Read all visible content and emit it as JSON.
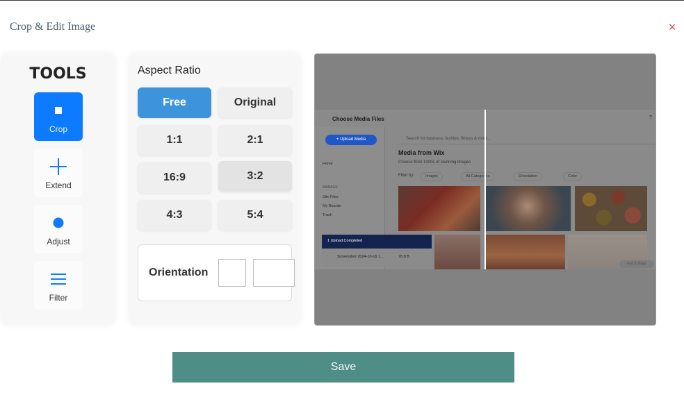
{
  "modal": {
    "title": "Crop & Edit Image",
    "close_symbol": "×"
  },
  "tools": {
    "title": "TOOLS",
    "items": [
      {
        "label": "Crop",
        "icon": "square-icon",
        "active": true
      },
      {
        "label": "Extend",
        "icon": "plus-icon",
        "active": false
      },
      {
        "label": "Adjust",
        "icon": "circle-icon",
        "active": false
      },
      {
        "label": "Filter",
        "icon": "menu-lines-icon",
        "active": false
      }
    ]
  },
  "aspect": {
    "title": "Aspect Ratio",
    "options": [
      "Free",
      "Original",
      "1:1",
      "2:1",
      "16:9",
      "3:2",
      "4:3",
      "5:4"
    ],
    "selected": "Free",
    "orientation_label": "Orientation"
  },
  "preview": {
    "dialog_title": "Choose Media Files",
    "help": "?",
    "close": "×",
    "upload_button": "+ Upload Media",
    "nav": [
      "Home",
      "MANAGE",
      "Site Files",
      "My Boards",
      "Trash"
    ],
    "search_placeholder": "Search for business, fashion, fitness & more...",
    "heading": "Media from Wix",
    "subheading": "Choose from 1000s of stunning images",
    "filter_label": "Filter by:",
    "filters": [
      "Images",
      "All Categories",
      "Orientation",
      "Color"
    ],
    "toast": "1 Upload Completed",
    "file_name": "Screenshot 2024-10-16 1...",
    "file_size": "78.8 B",
    "add_button": "Add to Page"
  },
  "colors": {
    "accent": "#0d7bff",
    "selected": "#3d94dd",
    "save": "#4f8d87",
    "close": "#e0443a"
  },
  "save_label": "Save"
}
